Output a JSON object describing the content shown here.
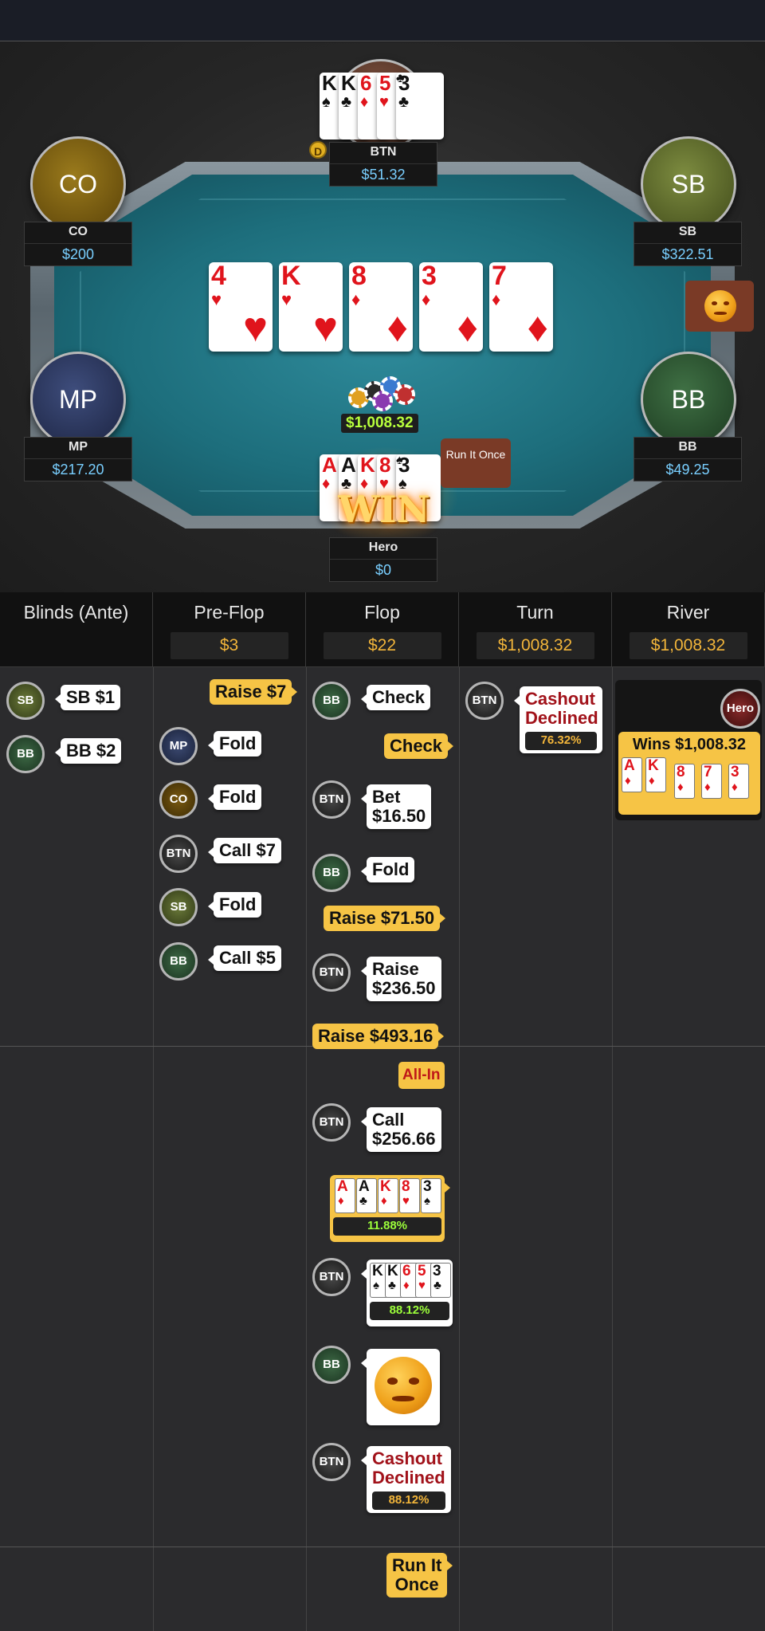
{
  "table": {
    "board": [
      {
        "rank": "4",
        "suit": "♥",
        "color": "red"
      },
      {
        "rank": "K",
        "suit": "♥",
        "color": "red"
      },
      {
        "rank": "8",
        "suit": "♦",
        "color": "red"
      },
      {
        "rank": "3",
        "suit": "♦",
        "color": "red"
      },
      {
        "rank": "7",
        "suit": "♦",
        "color": "red"
      }
    ],
    "pot": "$1,008.32",
    "dealer_label": "D",
    "run_it_once_bubble": "Run It Once",
    "win_label": "WIN",
    "seats": {
      "btn": {
        "name": "BTN",
        "stack": "$51.32",
        "cards": [
          {
            "rank": "K",
            "suit": "♠",
            "color": "blk"
          },
          {
            "rank": "K",
            "suit": "♣",
            "color": "blk"
          },
          {
            "rank": "6",
            "suit": "♦",
            "color": "red"
          },
          {
            "rank": "5",
            "suit": "♥",
            "color": "red"
          },
          {
            "rank": "3",
            "suit": "♣",
            "color": "blk"
          }
        ]
      },
      "co": {
        "avatar": "CO",
        "name": "CO",
        "stack": "$200",
        "color": "#7a5c12"
      },
      "sb": {
        "avatar": "SB",
        "name": "SB",
        "stack": "$322.51",
        "color": "#5d6b2c"
      },
      "mp": {
        "avatar": "MP",
        "name": "MP",
        "stack": "$217.20",
        "color": "#2c3658"
      },
      "bb": {
        "avatar": "BB",
        "name": "BB",
        "stack": "$49.25",
        "color": "#2f5632"
      },
      "hero": {
        "name": "Hero",
        "stack": "$0",
        "cards": [
          {
            "rank": "A",
            "suit": "♦",
            "color": "red"
          },
          {
            "rank": "A",
            "suit": "♣",
            "color": "blk"
          },
          {
            "rank": "K",
            "suit": "♦",
            "color": "red"
          },
          {
            "rank": "8",
            "suit": "♥",
            "color": "red"
          },
          {
            "rank": "3",
            "suit": "♠",
            "color": "blk"
          }
        ]
      }
    }
  },
  "history": {
    "columns": [
      {
        "title": "Blinds (Ante)",
        "pot": ""
      },
      {
        "title": "Pre-Flop",
        "pot": "$3"
      },
      {
        "title": "Flop",
        "pot": "$22"
      },
      {
        "title": "Turn",
        "pot": "$1,008.32"
      },
      {
        "title": "River",
        "pot": "$1,008.32"
      }
    ],
    "blinds": [
      {
        "pos": "SB",
        "action": "SB $1"
      },
      {
        "pos": "BB",
        "action": "BB $2"
      }
    ],
    "preflop": {
      "hero_raise": "Raise $7",
      "actions": [
        {
          "pos": "MP",
          "action": "Fold"
        },
        {
          "pos": "CO",
          "action": "Fold"
        },
        {
          "pos": "BTN",
          "action": "Call $7"
        },
        {
          "pos": "SB",
          "action": "Fold"
        },
        {
          "pos": "BB",
          "action": "Call $5"
        }
      ]
    },
    "flop": {
      "bb_check": {
        "pos": "BB",
        "action": "Check"
      },
      "hero_check": "Check",
      "btn_bet": {
        "pos": "BTN",
        "line1": "Bet",
        "line2": "$16.50"
      },
      "bb_fold": {
        "pos": "BB",
        "action": "Fold"
      },
      "hero_raise1": "Raise $71.50",
      "btn_raise": {
        "pos": "BTN",
        "line1": "Raise",
        "line2": "$236.50"
      },
      "hero_raise2": "Raise $493.16",
      "all_in": "All-In",
      "btn_call": {
        "pos": "BTN",
        "line1": "Call",
        "line2": "$256.66"
      },
      "hero_show": {
        "cards": [
          {
            "rank": "A",
            "suit": "♦",
            "color": "red"
          },
          {
            "rank": "A",
            "suit": "♣",
            "color": "blk"
          },
          {
            "rank": "K",
            "suit": "♦",
            "color": "red"
          },
          {
            "rank": "8",
            "suit": "♥",
            "color": "red"
          },
          {
            "rank": "3",
            "suit": "♠",
            "color": "blk"
          }
        ],
        "equity": "11.88%"
      },
      "btn_show": {
        "pos": "BTN",
        "cards": [
          {
            "rank": "K",
            "suit": "♠",
            "color": "blk"
          },
          {
            "rank": "K",
            "suit": "♣",
            "color": "blk"
          },
          {
            "rank": "6",
            "suit": "♦",
            "color": "red"
          },
          {
            "rank": "5",
            "suit": "♥",
            "color": "red"
          },
          {
            "rank": "3",
            "suit": "♣",
            "color": "blk"
          }
        ],
        "equity": "88.12%"
      },
      "bb_emote": {
        "pos": "BB"
      },
      "btn_cashout": {
        "pos": "BTN",
        "line1": "Cashout",
        "line2": "Declined",
        "equity": "88.12%"
      },
      "run_it_once": {
        "line1": "Run It",
        "line2": "Once"
      }
    },
    "turn": {
      "pos": "BTN",
      "line1": "Cashout",
      "line2": "Declined",
      "equity": "76.32%"
    },
    "river": {
      "winner": "Hero",
      "wins": "Wins $1,008.32",
      "hand": [
        {
          "rank": "A",
          "suit": "♦",
          "color": "red"
        },
        {
          "rank": "K",
          "suit": "♦",
          "color": "red"
        },
        {
          "rank": "8",
          "suit": "♦",
          "color": "red"
        },
        {
          "rank": "7",
          "suit": "♦",
          "color": "red"
        },
        {
          "rank": "3",
          "suit": "♦",
          "color": "red"
        }
      ]
    }
  }
}
